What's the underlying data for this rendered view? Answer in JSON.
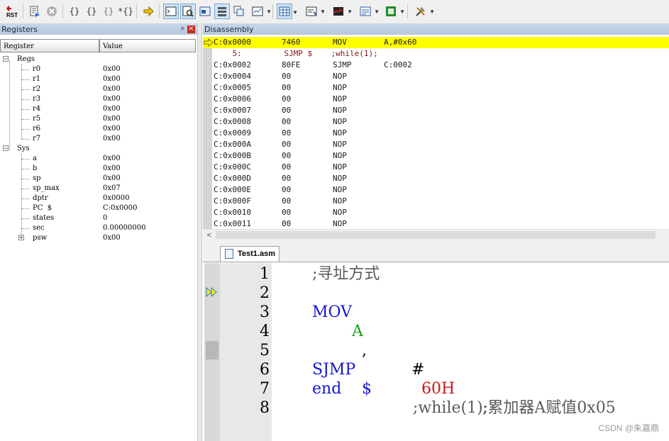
{
  "toolbar": {
    "buttons": [
      {
        "icon": "reset-icon",
        "label": "RST"
      },
      {
        "icon": "run-icon"
      },
      {
        "icon": "stop-icon"
      },
      {
        "icon": "step-into-icon",
        "label": "{}"
      },
      {
        "icon": "step-over-icon",
        "label": "{}"
      },
      {
        "icon": "step-out-icon",
        "label": "{}"
      },
      {
        "icon": "run-to-cursor-icon",
        "label": "*{}"
      },
      {
        "icon": "show-next-statement-icon"
      },
      {
        "icon": "command-window-icon"
      },
      {
        "icon": "disassembly-window-icon"
      },
      {
        "icon": "symbols-window-icon"
      },
      {
        "icon": "registers-window-icon"
      },
      {
        "icon": "call-stack-icon"
      },
      {
        "icon": "watch-windows-icon"
      },
      {
        "icon": "memory-windows-icon"
      },
      {
        "icon": "serial-windows-icon"
      },
      {
        "icon": "analysis-windows-icon"
      },
      {
        "icon": "trace-windows-icon"
      },
      {
        "icon": "system-viewer-icon"
      },
      {
        "icon": "toolbox-icon"
      }
    ]
  },
  "registers": {
    "title": "Registers",
    "pin": "ᵖ",
    "close": "×",
    "columns": {
      "name": "Register",
      "value": "Value"
    },
    "groups": [
      {
        "name": "Regs",
        "items": [
          {
            "name": "r0",
            "value": "0x00"
          },
          {
            "name": "r1",
            "value": "0x00"
          },
          {
            "name": "r2",
            "value": "0x00"
          },
          {
            "name": "r3",
            "value": "0x00"
          },
          {
            "name": "r4",
            "value": "0x00"
          },
          {
            "name": "r5",
            "value": "0x00"
          },
          {
            "name": "r6",
            "value": "0x00"
          },
          {
            "name": "r7",
            "value": "0x00"
          }
        ]
      },
      {
        "name": "Sys",
        "items": [
          {
            "name": "a",
            "value": "0x00"
          },
          {
            "name": "b",
            "value": "0x00"
          },
          {
            "name": "sp",
            "value": "0x00"
          },
          {
            "name": "sp_max",
            "value": "0x07"
          },
          {
            "name": "dptr",
            "value": "0x0000"
          },
          {
            "name": "PC  $",
            "value": "C:0x0000"
          },
          {
            "name": "states",
            "value": "0"
          },
          {
            "name": "sec",
            "value": "0.00000000"
          },
          {
            "name": "psw",
            "value": "0x00"
          }
        ]
      }
    ]
  },
  "disassembly": {
    "title": "Disassembly",
    "lines": [
      {
        "addr": "C:0x0000",
        "op": "7460",
        "mnem": "MOV",
        "args": "A,#0x60"
      },
      {
        "src": "    5:         SJMP $    ;while(1);"
      },
      {
        "addr": "C:0x0002",
        "op": "80FE",
        "mnem": "SJMP",
        "args": "C:0002"
      },
      {
        "addr": "C:0x0004",
        "op": "00",
        "mnem": "NOP",
        "args": ""
      },
      {
        "addr": "C:0x0005",
        "op": "00",
        "mnem": "NOP",
        "args": ""
      },
      {
        "addr": "C:0x0006",
        "op": "00",
        "mnem": "NOP",
        "args": ""
      },
      {
        "addr": "C:0x0007",
        "op": "00",
        "mnem": "NOP",
        "args": ""
      },
      {
        "addr": "C:0x0008",
        "op": "00",
        "mnem": "NOP",
        "args": ""
      },
      {
        "addr": "C:0x0009",
        "op": "00",
        "mnem": "NOP",
        "args": ""
      },
      {
        "addr": "C:0x000A",
        "op": "00",
        "mnem": "NOP",
        "args": ""
      },
      {
        "addr": "C:0x000B",
        "op": "00",
        "mnem": "NOP",
        "args": ""
      },
      {
        "addr": "C:0x000C",
        "op": "00",
        "mnem": "NOP",
        "args": ""
      },
      {
        "addr": "C:0x000D",
        "op": "00",
        "mnem": "NOP",
        "args": ""
      },
      {
        "addr": "C:0x000E",
        "op": "00",
        "mnem": "NOP",
        "args": ""
      },
      {
        "addr": "C:0x000F",
        "op": "00",
        "mnem": "NOP",
        "args": ""
      },
      {
        "addr": "C:0x0010",
        "op": "00",
        "mnem": "NOP",
        "args": ""
      },
      {
        "addr": "C:0x0011",
        "op": "00",
        "mnem": "NOP",
        "args": ""
      }
    ],
    "scroll_left": "<"
  },
  "editor": {
    "tab": "Test1.asm",
    "line_numbers": [
      "1",
      "2",
      "3",
      "4",
      "5",
      "6",
      "7",
      "8"
    ],
    "code": {
      "l1_comment": ";寻址方式",
      "l2_kw": "MOV",
      "l2_reg": "A",
      "l2_comma": ",",
      "l2_hash": "#",
      "l2_imm": "60H",
      "l2_comment": ";累加器A赋值0x05",
      "l5_kw": "SJMP",
      "l5_dollar": "$",
      "l5_comment": ";while(1);",
      "l7_kw": "end"
    }
  },
  "watermark": "CSDN @朱嘉鼎",
  "colors": {
    "highlight": "#ffff00",
    "keyword": "#1515cf",
    "immediate": "#cf1515",
    "register": "#12a012"
  }
}
